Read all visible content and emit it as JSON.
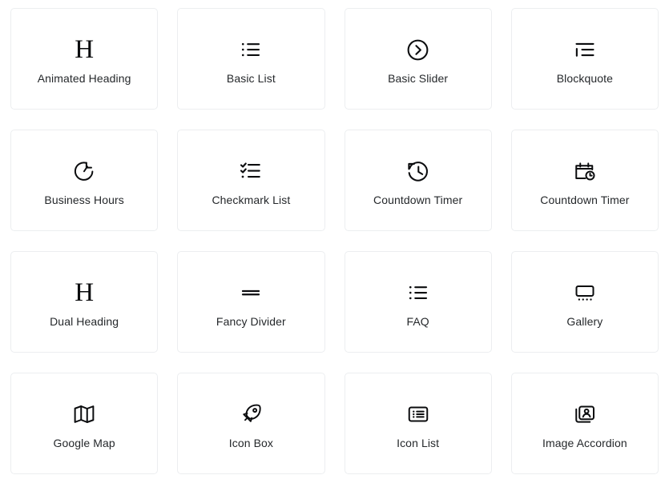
{
  "page": {
    "background_color": "#ffffff",
    "card_border_color": "#eceef0",
    "icon_color": "#0b0c0e",
    "label_color": "#25282b"
  },
  "grid": {
    "columns": 4,
    "rows": 4,
    "widgets": [
      {
        "label": "Animated Heading",
        "icon": "serif-h-icon"
      },
      {
        "label": "Basic List",
        "icon": "bulleted-list-icon"
      },
      {
        "label": "Basic Slider",
        "icon": "circle-chevron-right-icon"
      },
      {
        "label": "Blockquote",
        "icon": "blockquote-icon"
      },
      {
        "label": "Business Hours",
        "icon": "clock-timer-icon"
      },
      {
        "label": "Checkmark List",
        "icon": "checkmark-list-icon"
      },
      {
        "label": "Countdown Timer",
        "icon": "clock-rewind-icon"
      },
      {
        "label": "Countdown Timer",
        "icon": "calendar-clock-icon"
      },
      {
        "label": "Dual Heading",
        "icon": "serif-h-icon"
      },
      {
        "label": "Fancy Divider",
        "icon": "double-line-divider-icon"
      },
      {
        "label": "FAQ",
        "icon": "bulleted-list-icon"
      },
      {
        "label": "Gallery",
        "icon": "gallery-frame-dots-icon"
      },
      {
        "label": "Google Map",
        "icon": "folded-map-icon"
      },
      {
        "label": "Icon Box",
        "icon": "rocket-icon"
      },
      {
        "label": "Icon List",
        "icon": "boxed-list-icon"
      },
      {
        "label": "Image Accordion",
        "icon": "image-person-frame-icon"
      }
    ]
  }
}
